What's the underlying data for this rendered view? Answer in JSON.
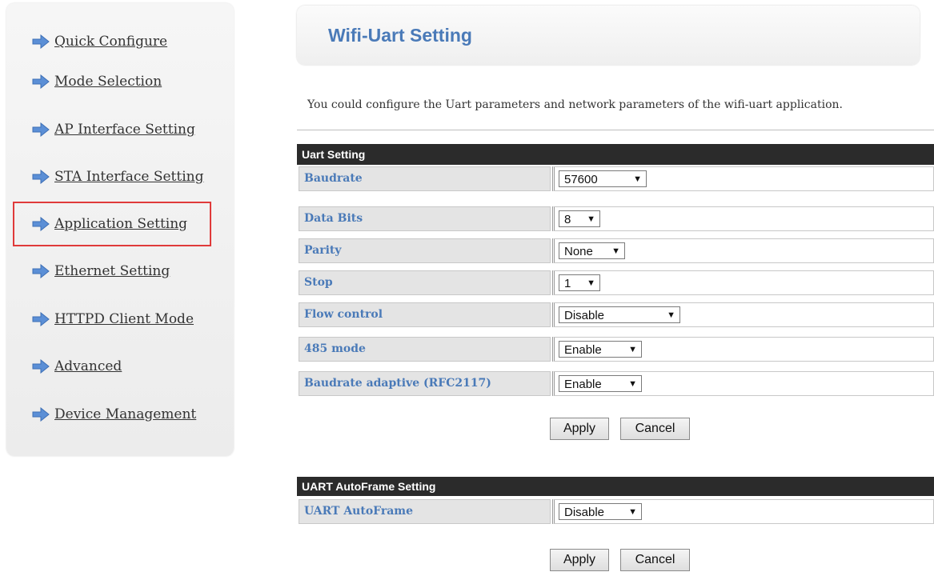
{
  "sidebar": {
    "items": [
      {
        "label": "Quick Configure"
      },
      {
        "label": "Mode Selection"
      },
      {
        "label": "AP Interface Setting"
      },
      {
        "label": "STA Interface Setting"
      },
      {
        "label": "Application Setting",
        "selected": true
      },
      {
        "label": "Ethernet Setting"
      },
      {
        "label": "HTTPD Client Mode"
      },
      {
        "label": "Advanced"
      },
      {
        "label": "Device Management"
      }
    ]
  },
  "page": {
    "title": "Wifi-Uart Setting",
    "description": "You could configure the Uart parameters and network parameters of the wifi-uart application."
  },
  "uart_section": {
    "header": "Uart Setting",
    "rows": [
      {
        "label": "Baudrate",
        "value": "57600"
      },
      {
        "label": "Data Bits",
        "value": "8"
      },
      {
        "label": "Parity",
        "value": "None"
      },
      {
        "label": "Stop",
        "value": "1"
      },
      {
        "label": "Flow control",
        "value": "Disable"
      },
      {
        "label": "485 mode",
        "value": "Enable"
      },
      {
        "label": "Baudrate adaptive (RFC2117)",
        "value": "Enable"
      }
    ],
    "apply_label": "Apply",
    "cancel_label": "Cancel"
  },
  "autoframe_section": {
    "header": "UART AutoFrame Setting",
    "rows": [
      {
        "label": "UART AutoFrame",
        "value": "Disable"
      }
    ],
    "apply_label": "Apply",
    "cancel_label": "Cancel"
  },
  "colors": {
    "accent_blue": "#4a7ab8",
    "header_bg": "#2b2b2b",
    "selected_outline": "#e03a3a",
    "arrow_blue": "#5b8fd6"
  },
  "icons": {
    "nav_arrow": "right-arrow-icon",
    "select_caret": "caret-down-icon"
  }
}
